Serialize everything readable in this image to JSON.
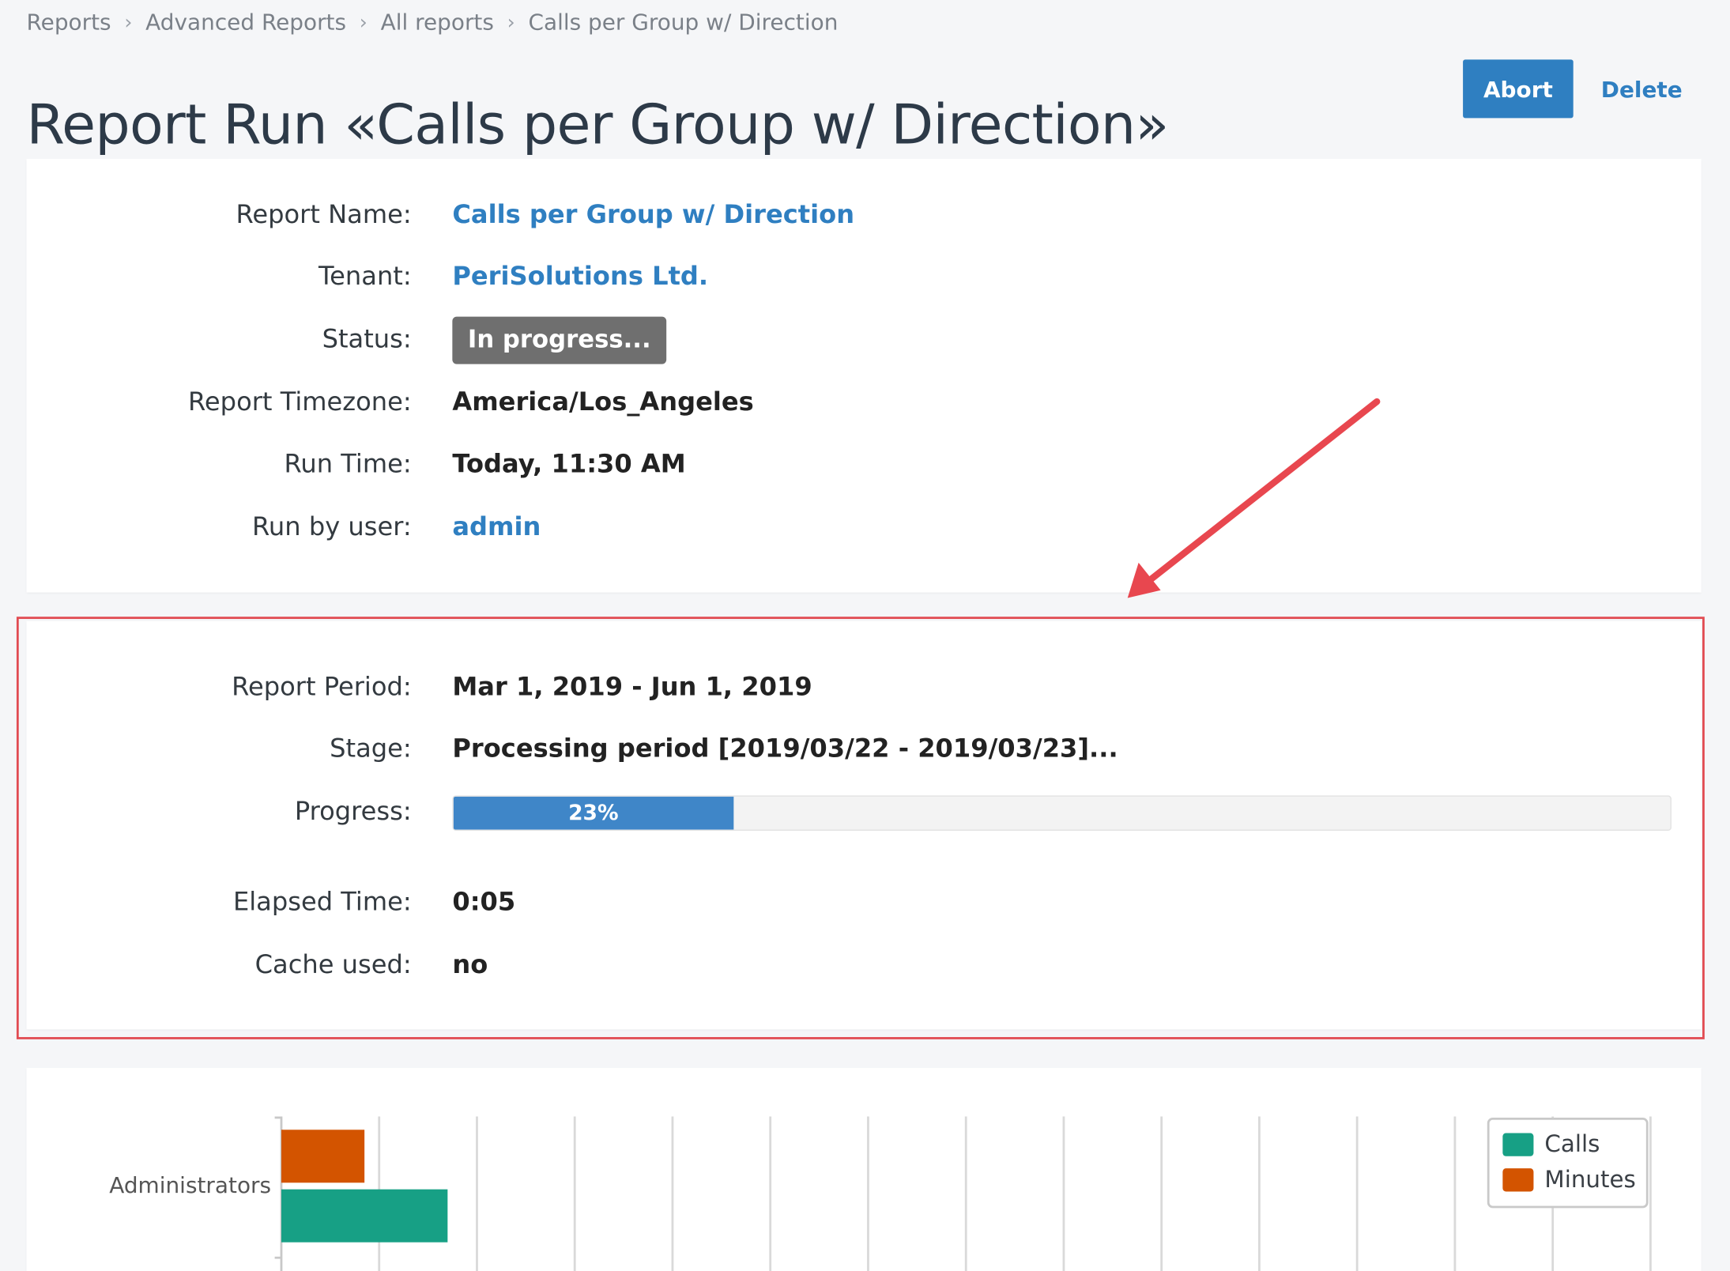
{
  "breadcrumb": [
    {
      "label": "Reports"
    },
    {
      "label": "Advanced Reports"
    },
    {
      "label": "All reports"
    },
    {
      "label": "Calls per Group w/ Direction"
    }
  ],
  "header": {
    "title": "Report Run «Calls per Group w/ Direction»",
    "abort_label": "Abort",
    "delete_label": "Delete"
  },
  "info": {
    "report_name": {
      "label": "Report Name:",
      "value": "Calls per Group w/ Direction"
    },
    "tenant": {
      "label": "Tenant:",
      "value": "PeriSolutions Ltd."
    },
    "status": {
      "label": "Status:",
      "value": "In progress..."
    },
    "timezone": {
      "label": "Report Timezone:",
      "value": "America/Los_Angeles"
    },
    "run_time": {
      "label": "Run Time:",
      "value": "Today, 11:30 AM"
    },
    "run_by": {
      "label": "Run by user:",
      "value": "admin"
    }
  },
  "progress_section": {
    "period": {
      "label": "Report Period:",
      "value": "Mar 1, 2019 - Jun 1, 2019"
    },
    "stage": {
      "label": "Stage:",
      "value": "Processing period [2019/03/22 - 2019/03/23]..."
    },
    "progress": {
      "label": "Progress:",
      "value_text": "23%",
      "fraction": 0.23
    },
    "elapsed": {
      "label": "Elapsed Time:",
      "value": "0:05"
    },
    "cache": {
      "label": "Cache used:",
      "value": "no"
    }
  },
  "colors": {
    "accent": "#2f7fc1",
    "highlight": "#e14b52",
    "progress_fill": "#3f86c8",
    "calls": "#17a085",
    "minutes": "#d35400"
  },
  "chart_data": {
    "type": "bar",
    "orientation": "horizontal",
    "categories": [
      "Administrators"
    ],
    "series": [
      {
        "name": "Minutes",
        "values": [
          17
        ],
        "color": "#d35400"
      },
      {
        "name": "Calls",
        "values": [
          34
        ],
        "color": "#17a085"
      }
    ],
    "legend": [
      "Calls",
      "Minutes"
    ],
    "legend_placement": "top-right",
    "grid": true,
    "xlim": [
      0,
      280
    ],
    "x_tick_step": 20
  }
}
